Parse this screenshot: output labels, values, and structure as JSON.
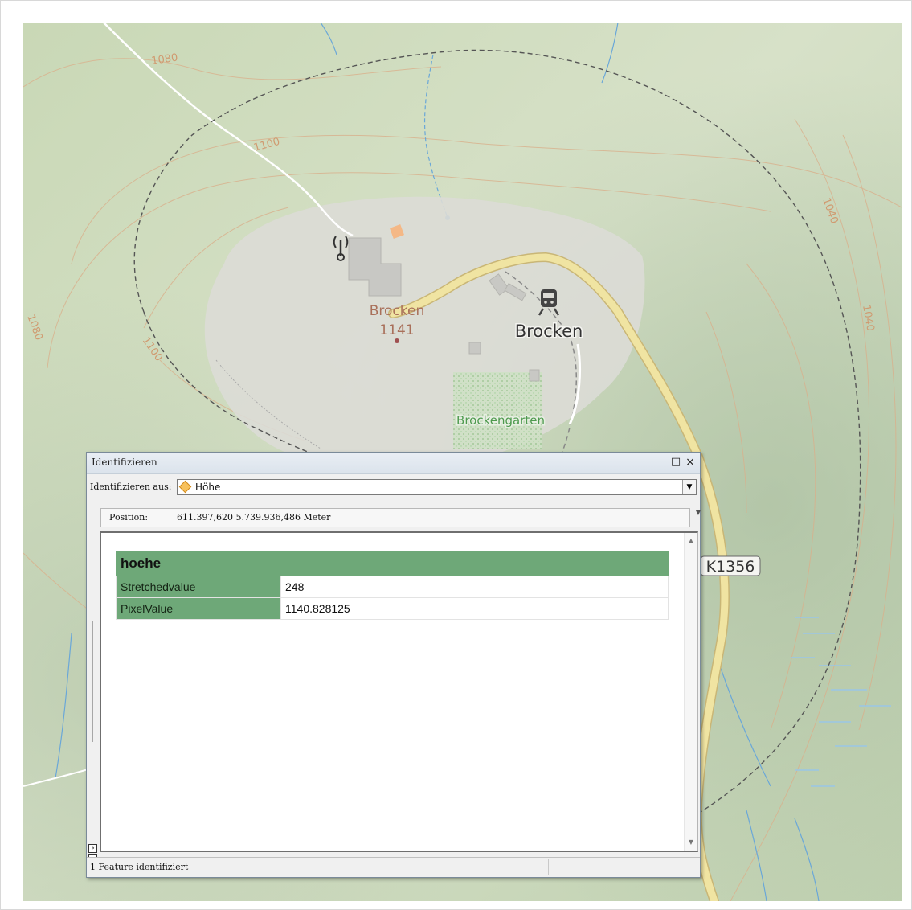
{
  "map": {
    "contour_labels": [
      "1080",
      "1100",
      "1080",
      "1100",
      "1040",
      "1040"
    ],
    "peak_name": "Brocken",
    "peak_elevation": "1141",
    "station_label": "Brocken",
    "garden_label": "Brockengarten",
    "road_label": "K1356",
    "icons": [
      "antenna-icon",
      "train-station-icon"
    ]
  },
  "identify": {
    "title": "Identifizieren",
    "maximize_glyph": "□",
    "close_glyph": "×",
    "source_label": "Identifizieren aus:",
    "source_value": "Höhe",
    "position_label": "Position:",
    "position_value": "611.397,620  5.739.936,486 Meter",
    "table": {
      "header": "hoehe",
      "rows": [
        {
          "name": "Stretchedvalue",
          "value": "248"
        },
        {
          "name": "PixelValue",
          "value": "1140.828125"
        }
      ]
    },
    "status": "1 Feature identifiziert",
    "colors": {
      "table_accent": "#6ea878",
      "titlebar": "#dbe3ec"
    }
  }
}
